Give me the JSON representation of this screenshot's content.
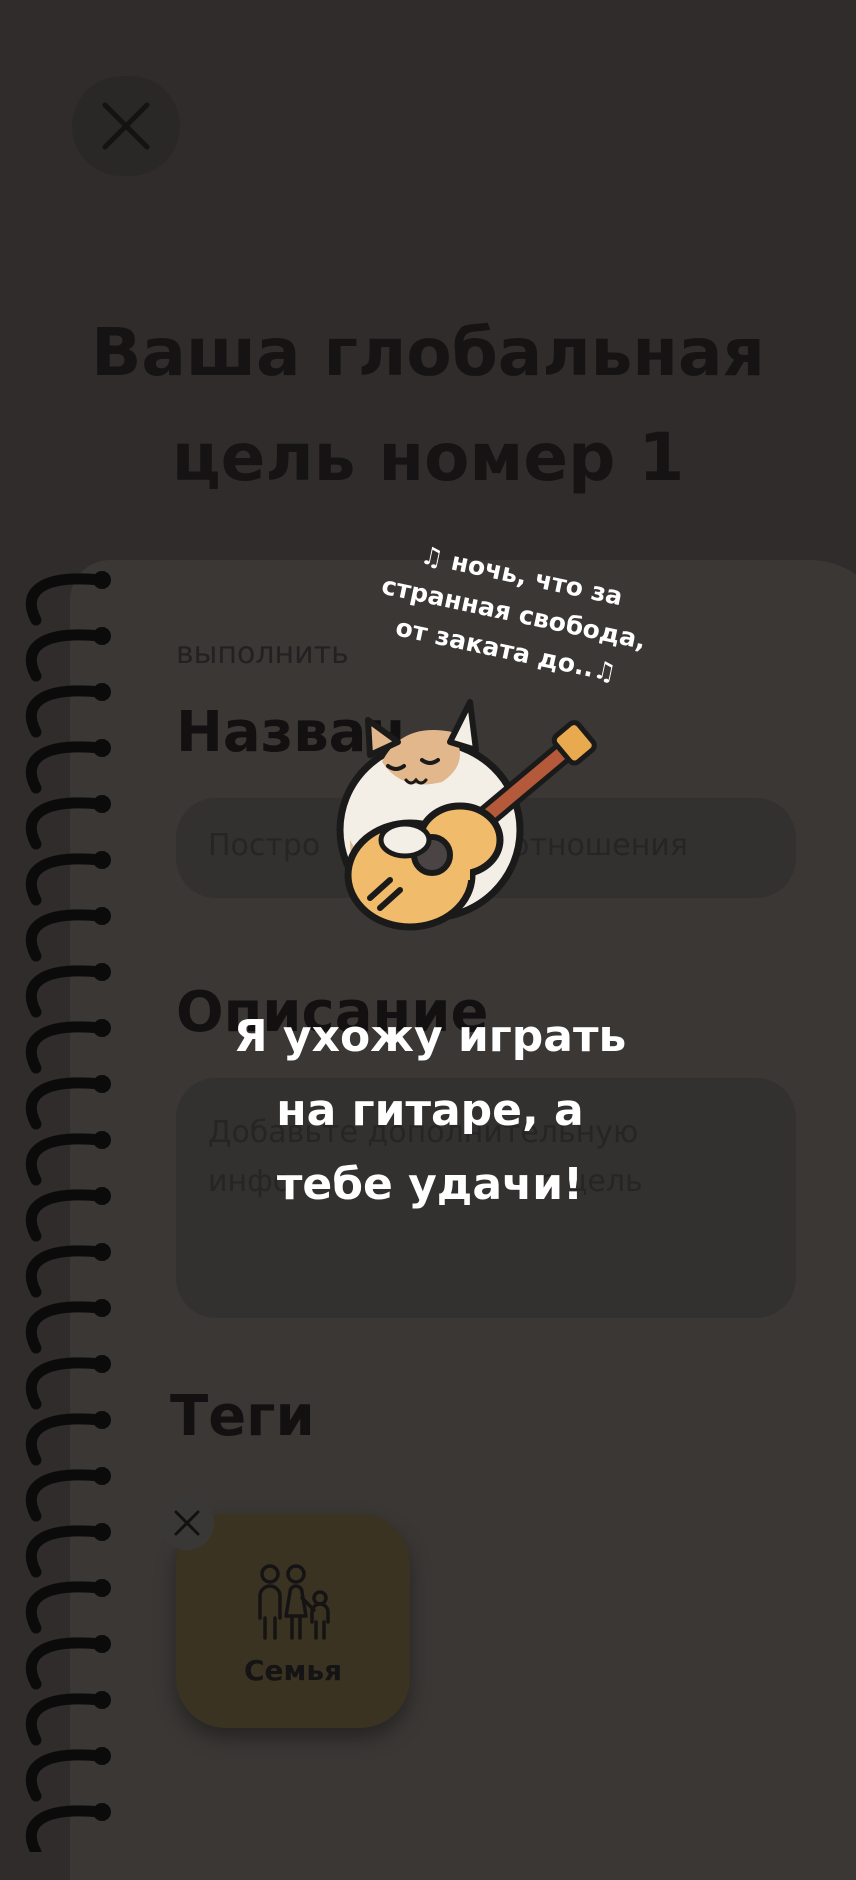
{
  "screen": {
    "goal_title_line1": "Ваша глобальная",
    "goal_title_line2": "цель номер 1",
    "subtitle": "выполнить",
    "name_label": "Назван",
    "name_placeholder": "Постро                    отношения",
    "description_label": "Описание",
    "description_placeholder_line1": "Добавьте дополнительную",
    "description_placeholder_line2": "инфо                          о цель",
    "tags_label": "Теги",
    "tags": [
      {
        "label": "Семья",
        "icon": "family-icon"
      }
    ]
  },
  "overlay": {
    "song_line1": "♫ ночь, что за",
    "song_line2": "странная свобода,",
    "song_line3": "от заката до..♫",
    "message_line1": "Я ухожу играть",
    "message_line2": "на гитаре, а",
    "message_line3": "тебе удачи!",
    "illustration": "cat-with-guitar"
  },
  "colors": {
    "background": "#2f2c2b",
    "sheet": "#3a3735",
    "tag_background": "#3b3322",
    "overlay_text": "#ffffff"
  }
}
